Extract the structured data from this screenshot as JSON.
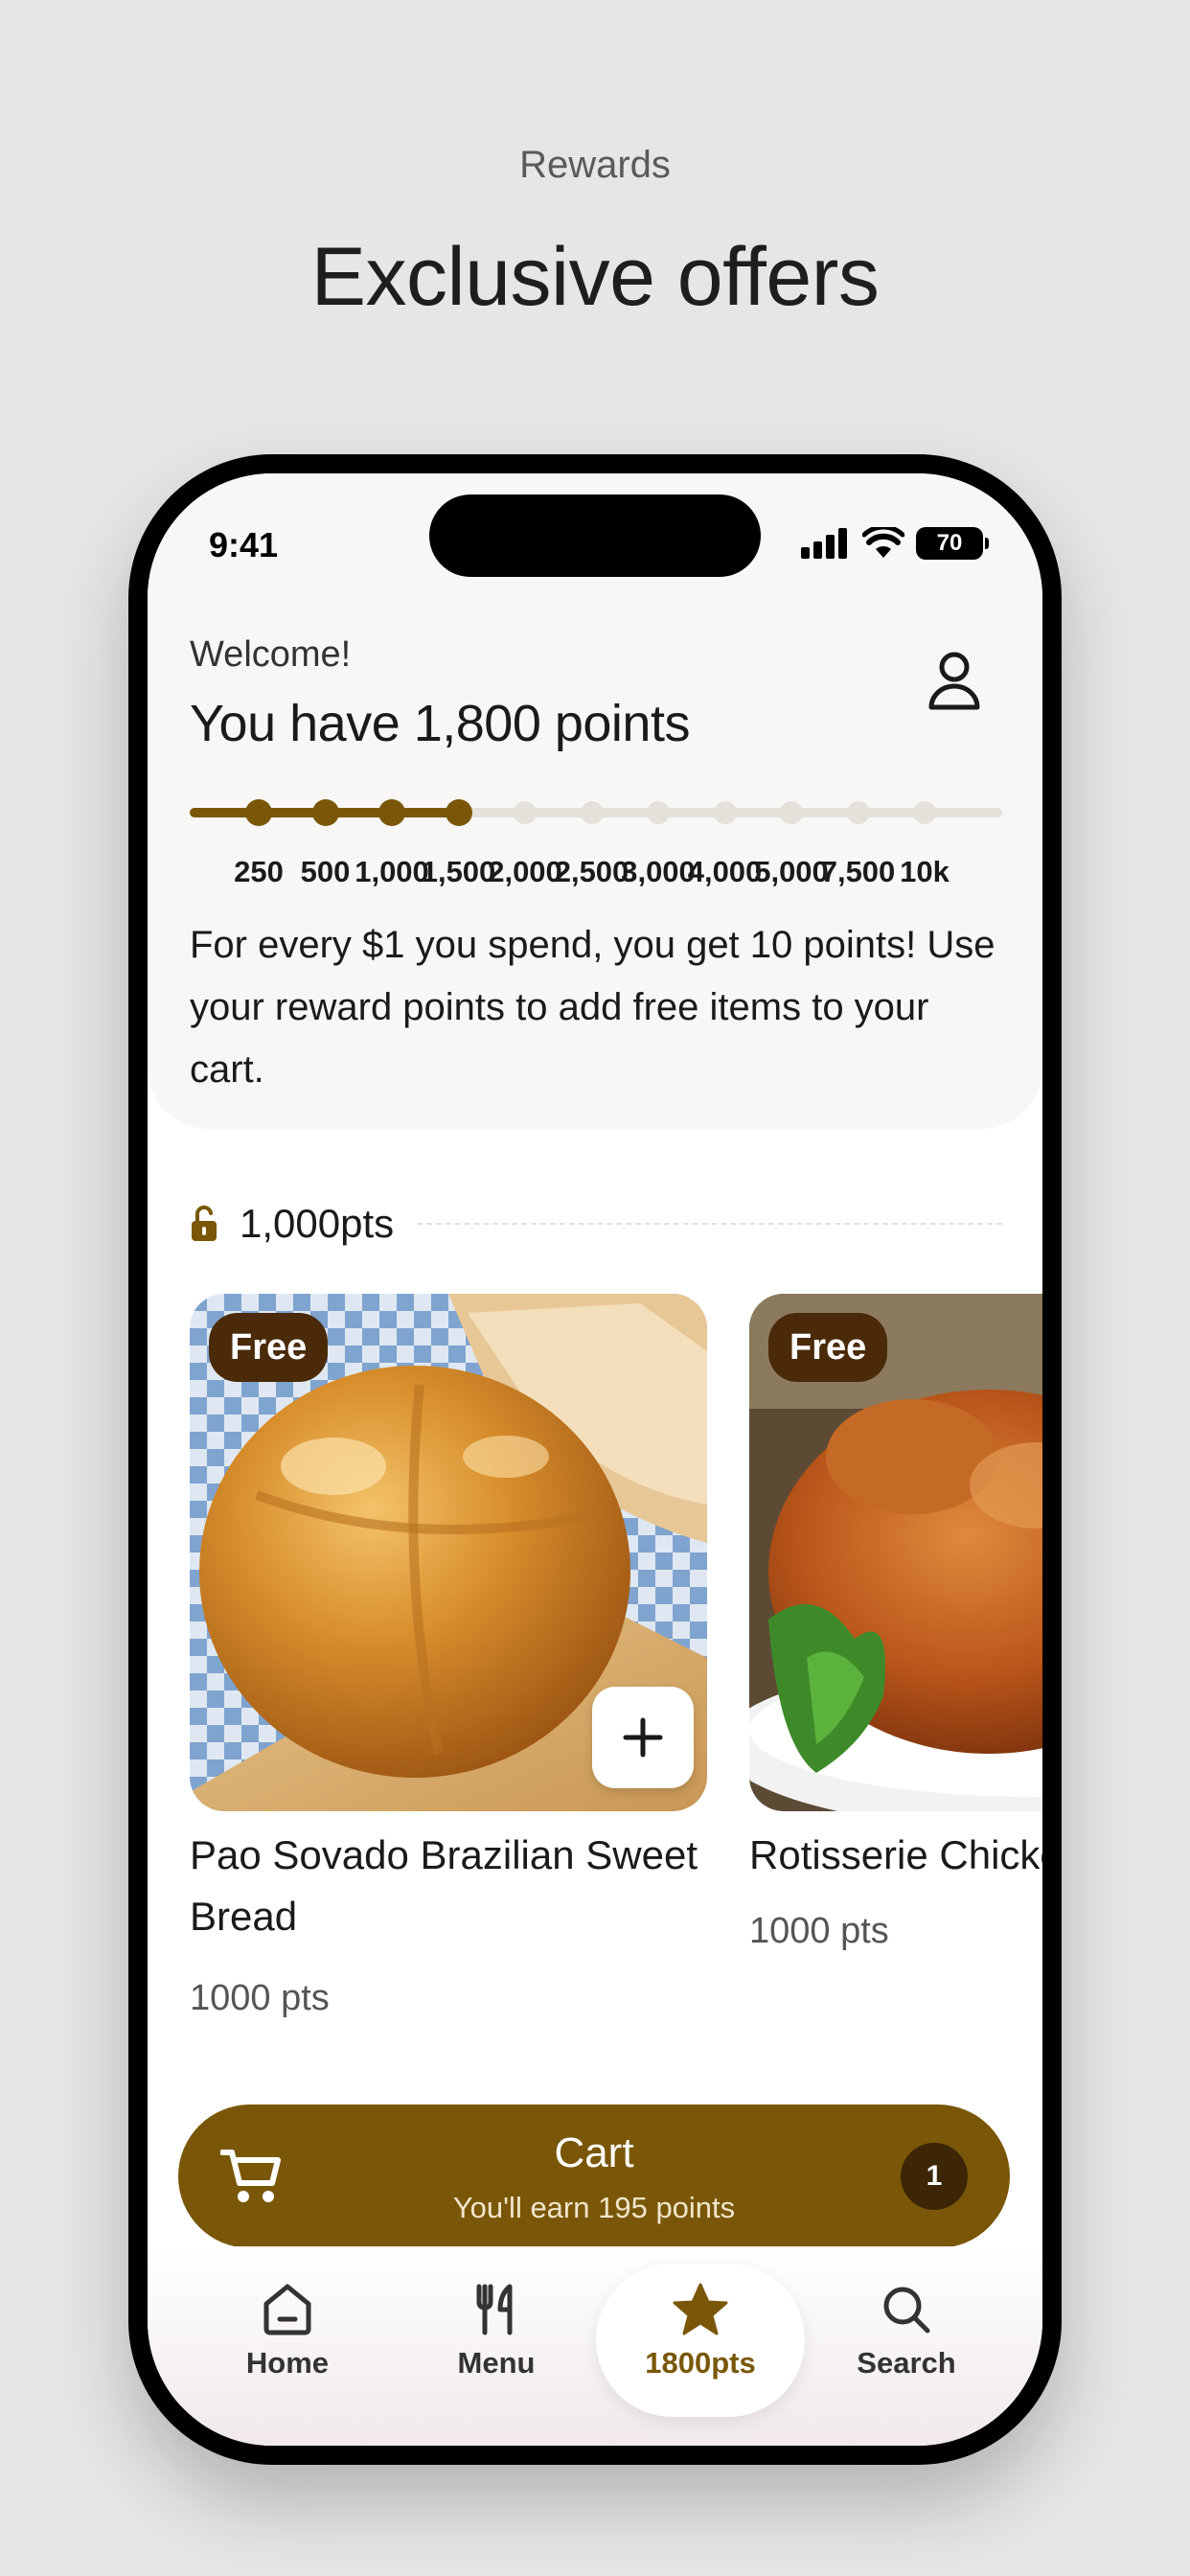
{
  "page": {
    "subtitle": "Rewards",
    "title": "Exclusive offers"
  },
  "status_bar": {
    "time": "9:41",
    "battery": "70"
  },
  "header": {
    "welcome": "Welcome!",
    "points_heading": "You have 1,800 points",
    "points": 1800,
    "tiers": [
      "250",
      "500",
      "1,000",
      "1,500",
      "2,000",
      "2,500",
      "3,000",
      "4,000",
      "5,000",
      "7,500",
      "10k"
    ],
    "info": "For every $1 you spend, you get 10 points! Use your reward points to add free items to your cart."
  },
  "section": {
    "tier_label": "1,000pts"
  },
  "products": [
    {
      "badge": "Free",
      "name": "Pao Sovado Brazilian Sweet Bread",
      "pts": "1000 pts"
    },
    {
      "badge": "Free",
      "name": "Rotisserie Chicken",
      "pts": "1000 pts"
    }
  ],
  "cart": {
    "title": "Cart",
    "subtitle": "You'll earn 195 points",
    "count": "1"
  },
  "nav": {
    "home": "Home",
    "menu": "Menu",
    "points": "1800pts",
    "search": "Search"
  },
  "colors": {
    "accent": "#7a5708",
    "badge": "#4a2a08",
    "track": "#e4e1db"
  }
}
